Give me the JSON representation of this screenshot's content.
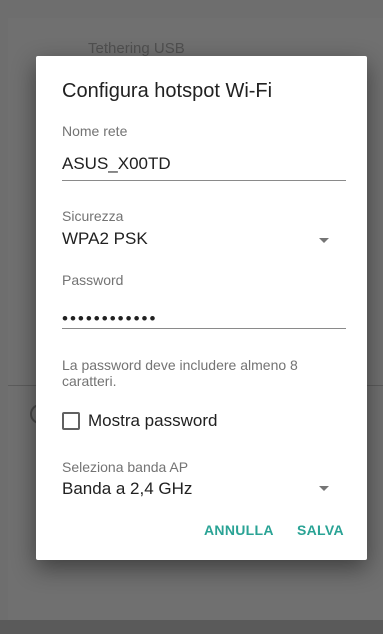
{
  "background": {
    "top_item": "Tethering USB",
    "right_fragment": "i."
  },
  "dialog": {
    "title": "Configura hotspot Wi-Fi",
    "network_name_label": "Nome rete",
    "network_name_value": "ASUS_X00TD",
    "security_label": "Sicurezza",
    "security_value": "WPA2 PSK",
    "password_label": "Password",
    "password_value": "••••••••••••",
    "password_hint": "La password deve includere almeno 8 caratteri.",
    "show_password_label": "Mostra password",
    "show_password_checked": false,
    "ap_band_label": "Seleziona banda AP",
    "ap_band_value": "Banda a 2,4 GHz",
    "cancel_label": "ANNULLA",
    "save_label": "SALVA"
  },
  "colors": {
    "accent": "#2aa395",
    "scrim": "#6e6e6e"
  }
}
